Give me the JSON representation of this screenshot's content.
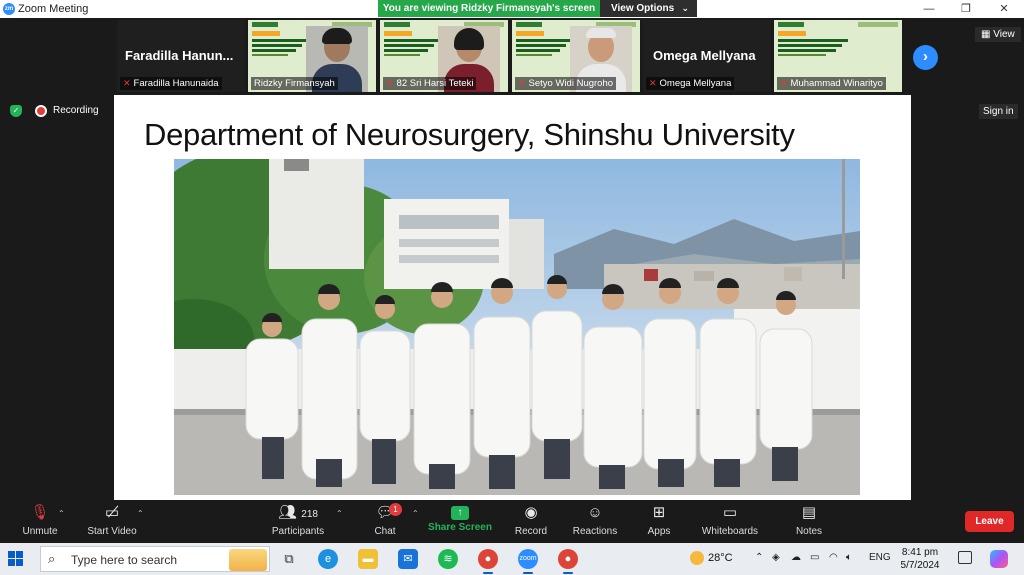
{
  "window": {
    "title": "Zoom Meeting",
    "share_banner": "You are viewing Ridzky Firmansyah's screen",
    "view_options": "View Options"
  },
  "participants": [
    {
      "display": "Faradilla  Hanun...",
      "name": "Faradilla Hanunaida",
      "type": "name-only"
    },
    {
      "display": "",
      "name": "Ridzky Firmansyah",
      "type": "video"
    },
    {
      "display": "",
      "name": "82 Sri Harsi Teteki",
      "type": "video"
    },
    {
      "display": "",
      "name": "Setyo Widi Nugroho",
      "type": "video"
    },
    {
      "display": "Omega Mellyana",
      "name": "Omega Mellyana",
      "type": "name-only"
    },
    {
      "display": "",
      "name": "Muhammad Winarityo",
      "type": "slide"
    }
  ],
  "view_button": "View",
  "meeting": {
    "recording": "Recording",
    "sign_in": "Sign in"
  },
  "slide": {
    "title": "Department of Neurosurgery, Shinshu University"
  },
  "toolbar": {
    "unmute": "Unmute",
    "start_video": "Start Video",
    "participants_label": "Participants",
    "participants_count": "218",
    "chat": "Chat",
    "chat_badge": "1",
    "share_screen": "Share Screen",
    "record": "Record",
    "reactions": "Reactions",
    "apps": "Apps",
    "whiteboards": "Whiteboards",
    "notes": "Notes",
    "leave": "Leave"
  },
  "taskbar": {
    "search_placeholder": "Type here to search",
    "temperature": "28°C",
    "language": "ENG",
    "time": "8:41 pm",
    "date": "5/7/2024"
  }
}
